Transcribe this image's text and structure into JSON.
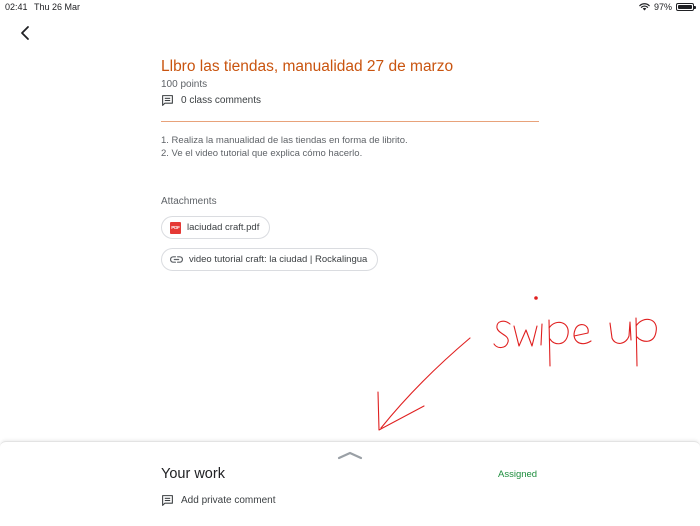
{
  "status_bar": {
    "time": "02:41",
    "date": "Thu 26 Mar",
    "battery": "97%",
    "battery_level": 0.97
  },
  "assignment": {
    "title": "Llbro las tiendas, manualidad 27 de marzo",
    "points": "100 points",
    "comments_label": "0 class comments",
    "instructions": [
      "1. Realiza la manualidad de las tiendas en forma de librito.",
      "2. Ve el video tutorial que explica cómo hacerlo."
    ],
    "attachments_label": "Attachments",
    "attachments": [
      {
        "icon": "pdf-icon",
        "label": "laciudad craft.pdf"
      },
      {
        "icon": "link-icon",
        "label": "video tutorial craft: la ciudad | Rockalingua"
      }
    ]
  },
  "annotation": {
    "text": "swipe up",
    "color": "#e02020"
  },
  "your_work": {
    "title": "Your work",
    "status": "Assigned",
    "private_comment_label": "Add private comment"
  },
  "colors": {
    "accent": "#c9540f",
    "assigned": "#1e8e3e"
  }
}
